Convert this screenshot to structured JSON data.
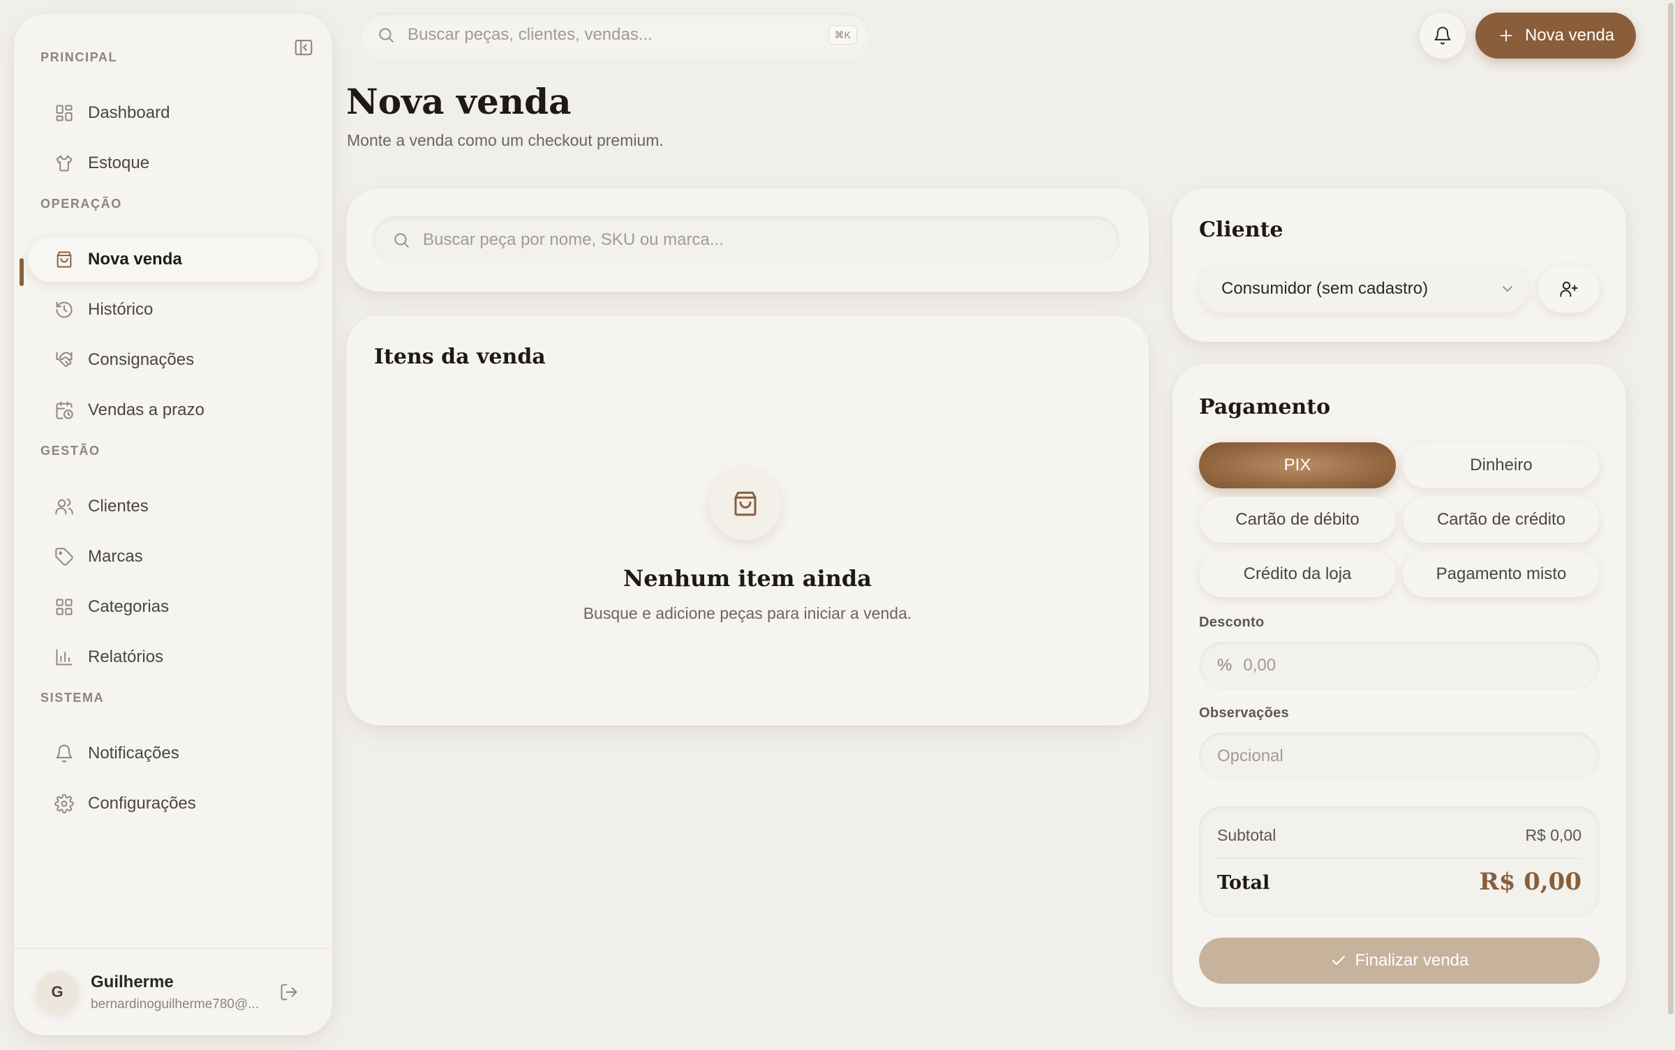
{
  "top_search": {
    "placeholder": "Buscar peças, clientes, vendas...",
    "shortcut": "⌘K"
  },
  "header": {
    "new_sale_label": "Nova venda"
  },
  "sidebar": {
    "sections": {
      "principal": "PRINCIPAL",
      "operacao": "OPERAÇÃO",
      "gestao": "GESTÃO",
      "sistema": "SISTEMA"
    },
    "items": [
      {
        "label": "Dashboard",
        "icon": "grid-icon"
      },
      {
        "label": "Estoque",
        "icon": "shirt-icon"
      },
      {
        "label": "Nova venda",
        "icon": "shopping-bag-icon",
        "active": true
      },
      {
        "label": "Histórico",
        "icon": "history-icon"
      },
      {
        "label": "Consignações",
        "icon": "handshake-icon"
      },
      {
        "label": "Vendas a prazo",
        "icon": "calendar-clock-icon"
      },
      {
        "label": "Clientes",
        "icon": "users-icon"
      },
      {
        "label": "Marcas",
        "icon": "tag-icon"
      },
      {
        "label": "Categorias",
        "icon": "grid-icon"
      },
      {
        "label": "Relatórios",
        "icon": "bar-chart-icon"
      },
      {
        "label": "Notificações",
        "icon": "bell-icon"
      },
      {
        "label": "Configurações",
        "icon": "gear-icon"
      }
    ],
    "user": {
      "initial": "G",
      "name": "Guilherme",
      "email": "bernardinoguilherme780@..."
    }
  },
  "page": {
    "title": "Nova venda",
    "subtitle": "Monte a venda como um checkout premium."
  },
  "item_search": {
    "placeholder": "Buscar peça por nome, SKU ou marca..."
  },
  "items_card": {
    "title": "Itens da venda",
    "empty_title": "Nenhum item ainda",
    "empty_subtitle": "Busque e adicione peças para iniciar a venda."
  },
  "client": {
    "title": "Cliente",
    "selected": "Consumidor (sem cadastro)"
  },
  "payment": {
    "title": "Pagamento",
    "methods": [
      "PIX",
      "Dinheiro",
      "Cartão de débito",
      "Cartão de crédito",
      "Crédito da loja",
      "Pagamento misto"
    ],
    "selected": "PIX",
    "discount_label": "Desconto",
    "discount_symbol": "%",
    "discount_placeholder": "0,00",
    "notes_label": "Observações",
    "notes_placeholder": "Opcional",
    "subtotal_label": "Subtotal",
    "subtotal_value": "R$ 0,00",
    "total_label": "Total",
    "total_value": "R$ 0,00",
    "finalize_label": "Finalizar venda"
  },
  "colors": {
    "accent": "#8a5e3b",
    "background": "#f1efea",
    "card": "#f6f4f0",
    "finalize_disabled": "#c7b29c"
  }
}
